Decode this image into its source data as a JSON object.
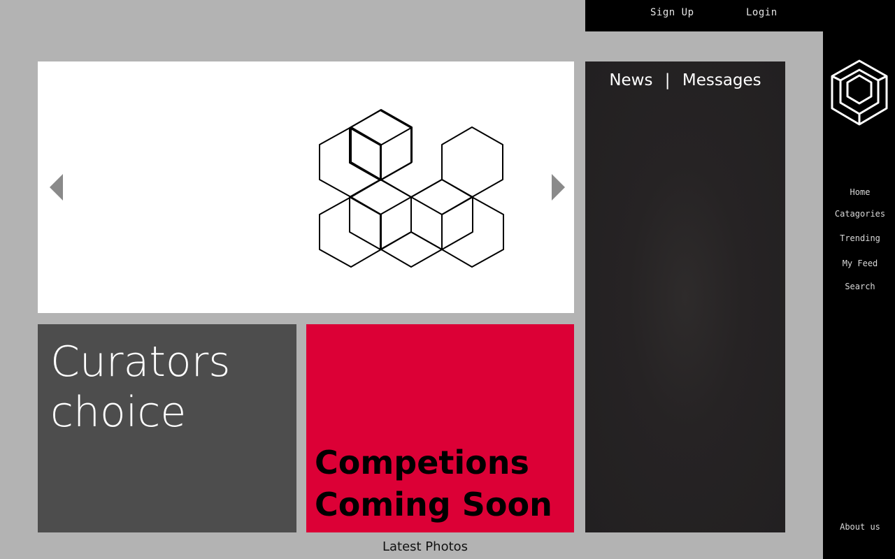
{
  "auth": {
    "signup_label": "Sign Up",
    "login_label": "Login"
  },
  "sidebar": {
    "logo_icon": "hexagon-cube-logo-icon",
    "items": [
      {
        "label": "Home"
      },
      {
        "label": "Catagories"
      },
      {
        "label": "Trending"
      },
      {
        "label": "My Feed"
      },
      {
        "label": "Search"
      }
    ],
    "footer_label": "About us"
  },
  "slider": {
    "prev_icon": "triangle-left-icon",
    "next_icon": "triangle-right-icon",
    "artwork_icon": "hexagon-cubes-artwork"
  },
  "tiles": {
    "curators": {
      "line1": "Curators",
      "line2": "choice"
    },
    "competitions": {
      "line1": "Competions",
      "line2": "Coming Soon"
    }
  },
  "news": {
    "tab_news": "News",
    "separator": "|",
    "tab_messages": "Messages"
  },
  "latest_label": "Latest Photos",
  "colors": {
    "page_bg": "#b3b3b3",
    "bar_bg": "#000000",
    "curators_bg": "#4d4d4d",
    "competitions_bg": "#dc0036",
    "news_bg": "#252223"
  }
}
